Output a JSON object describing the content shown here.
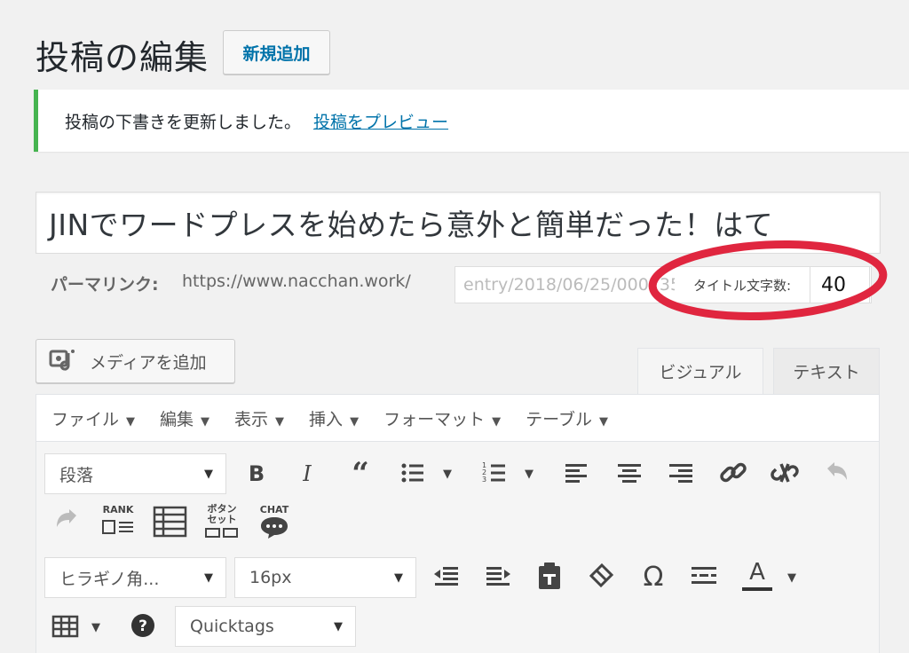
{
  "header": {
    "title": "投稿の編集",
    "add_new": "新規追加"
  },
  "notice": {
    "message": "投稿の下書きを更新しました。",
    "preview_link": "投稿をプレビュー"
  },
  "post": {
    "title": "JINでワードプレスを始めたら意外と簡単だった！はて",
    "permalink_label": "パーマリンク:",
    "permalink_base": "https://www.nacchan.work/",
    "permalink_slug": "entry/2018/06/25/000735",
    "title_count_label": "タイトル文字数:",
    "title_count": "40"
  },
  "media": {
    "add_media": "メディアを追加"
  },
  "tabs": {
    "visual": "ビジュアル",
    "text": "テキスト"
  },
  "menubar": [
    "ファイル",
    "編集",
    "表示",
    "挿入",
    "フォーマット",
    "テーブル"
  ],
  "toolbar": {
    "format_select": "段落",
    "font_select": "ヒラギノ角...",
    "size_select": "16px",
    "quicktags_select": "Quicktags",
    "rank_label": "RANK",
    "button_set_label_1": "ボタン",
    "button_set_label_2": "セット",
    "chat_label": "CHAT",
    "special_char": "Ω",
    "text_color": "A"
  },
  "colors": {
    "accent": "#0073aa",
    "success": "#46b450",
    "highlight": "#e0263f"
  }
}
